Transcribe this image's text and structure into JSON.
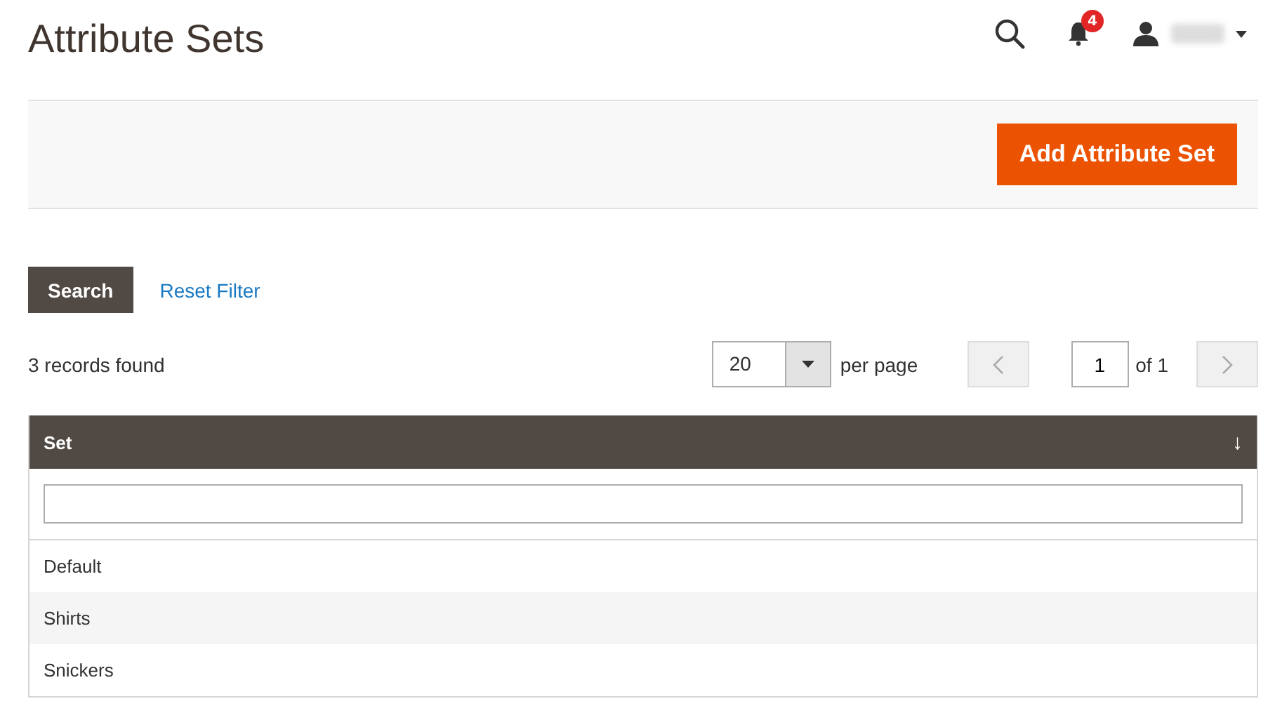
{
  "page_title": "Attribute Sets",
  "header": {
    "notification_count": "4"
  },
  "actions": {
    "primary_button": "Add Attribute Set"
  },
  "filters": {
    "search_button": "Search",
    "reset_link": "Reset Filter"
  },
  "pager": {
    "records": "3 records found",
    "per_page_value": "20",
    "per_page_label": "per page",
    "prev_disabled": true,
    "page_value": "1",
    "page_total": "of 1",
    "next_disabled": true
  },
  "table": {
    "columns": [
      {
        "label": "Set",
        "sort_indicator": "↓"
      }
    ],
    "rows": [
      {
        "set": "Default"
      },
      {
        "set": "Shirts"
      },
      {
        "set": "Snickers"
      }
    ]
  }
}
